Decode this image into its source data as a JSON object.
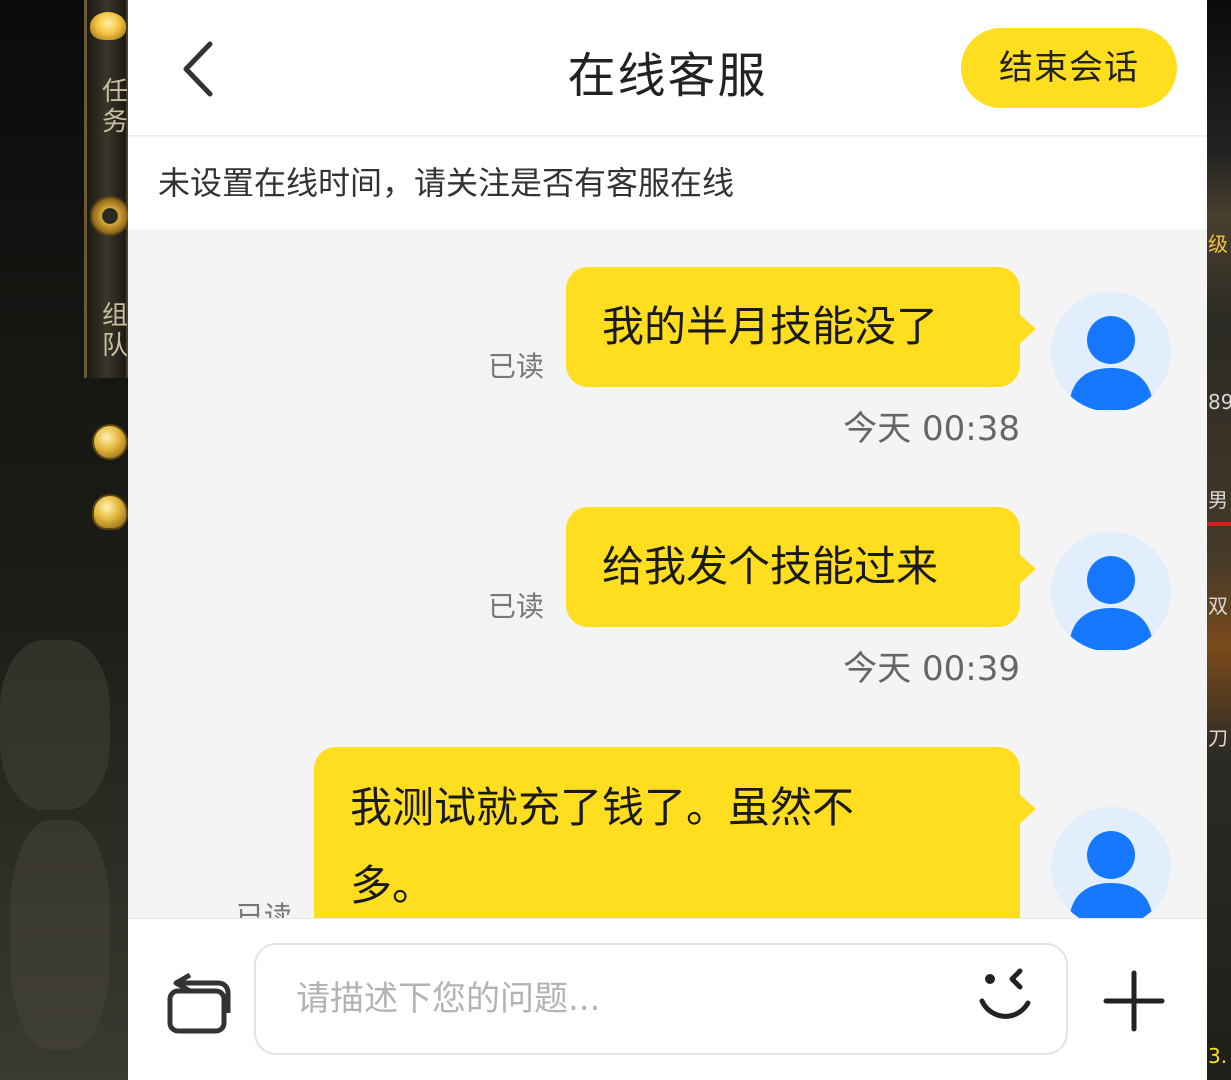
{
  "header": {
    "title": "在线客服",
    "end_label": "结束会话"
  },
  "notice": "未设置在线时间，请关注是否有客服在线",
  "messages": [
    {
      "text": "我的半月技能没了",
      "status": "已读",
      "time": "今天 00:38"
    },
    {
      "text": "给我发个技能过来",
      "status": "已读",
      "time": "今天 00:39"
    },
    {
      "text_line1": "我测试就充了钱了。虽然不",
      "text_line2": "多。",
      "status": "已读"
    }
  ],
  "input": {
    "placeholder": "请描述下您的问题..."
  },
  "game_bg": {
    "left_labels": [
      "任",
      "务",
      "组",
      "队"
    ],
    "right_labels": [
      "级",
      "89",
      "男",
      "双",
      "刀",
      "3."
    ]
  },
  "colors": {
    "accent": "#ffde1f",
    "avatar_bg": "#e2eefc",
    "avatar_fg": "#1677ff",
    "chat_bg": "#f4f4f4"
  },
  "icons": [
    "back-icon",
    "switch-keyboard-icon",
    "emoji-icon",
    "plus-icon",
    "user-avatar-icon"
  ]
}
